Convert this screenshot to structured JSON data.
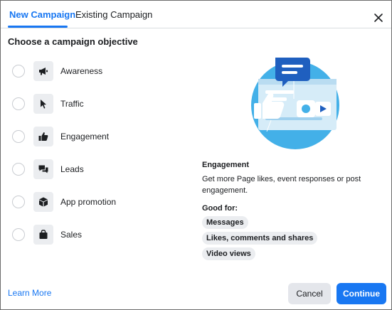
{
  "tabs": [
    {
      "label": "New Campaign",
      "active": true
    },
    {
      "label": "Existing Campaign",
      "active": false
    }
  ],
  "heading": "Choose a campaign objective",
  "objectives": [
    {
      "label": "Awareness",
      "icon": "megaphone-icon"
    },
    {
      "label": "Traffic",
      "icon": "cursor-icon"
    },
    {
      "label": "Engagement",
      "icon": "thumbs-up-icon"
    },
    {
      "label": "Leads",
      "icon": "chat-bubbles-icon"
    },
    {
      "label": "App promotion",
      "icon": "cube-icon"
    },
    {
      "label": "Sales",
      "icon": "shopping-bag-icon"
    }
  ],
  "detail": {
    "title": "Engagement",
    "description": "Get more Page likes, event responses or post engagement.",
    "good_for_label": "Good for:",
    "tags": [
      "Messages",
      "Likes, comments and shares",
      "Video views"
    ]
  },
  "footer": {
    "learn_more": "Learn More",
    "cancel": "Cancel",
    "continue": "Continue"
  },
  "colors": {
    "accent": "#1877f2",
    "illustration_circle": "#43b0e8",
    "chip_bg": "#ebedf0"
  }
}
